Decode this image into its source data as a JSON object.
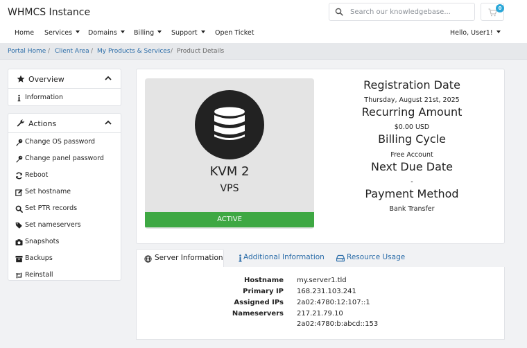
{
  "header": {
    "brand": "WHMCS Instance",
    "search_placeholder": "Search our knowledgebase...",
    "cart_count": "0"
  },
  "nav": {
    "items": [
      "Home",
      "Services",
      "Domains",
      "Billing",
      "Support",
      "Open Ticket"
    ],
    "user_menu": "Hello, User1!"
  },
  "breadcrumb": {
    "items": [
      "Portal Home",
      "Client Area",
      "My Products & Services",
      "Product Details"
    ],
    "separator": "/"
  },
  "sidebar": {
    "overview": {
      "title": "Overview",
      "items": [
        {
          "label": "Information",
          "icon": "info-icon"
        }
      ]
    },
    "actions": {
      "title": "Actions",
      "items": [
        {
          "label": "Change OS password",
          "icon": "key-icon"
        },
        {
          "label": "Change panel password",
          "icon": "key-icon"
        },
        {
          "label": "Reboot",
          "icon": "refresh-icon"
        },
        {
          "label": "Set hostname",
          "icon": "edit-icon"
        },
        {
          "label": "Set PTR records",
          "icon": "search-icon"
        },
        {
          "label": "Set nameservers",
          "icon": "tags-icon"
        },
        {
          "label": "Snapshots",
          "icon": "camera-icon"
        },
        {
          "label": "Backups",
          "icon": "archive-icon"
        },
        {
          "label": "Reinstall",
          "icon": "retweet-icon"
        }
      ]
    }
  },
  "product": {
    "name": "KVM 2",
    "group": "VPS",
    "status": "ACTIVE",
    "icon": "database-icon"
  },
  "details": {
    "registration_date_label": "Registration Date",
    "registration_date": "Thursday, August 21st, 2025",
    "recurring_amount_label": "Recurring Amount",
    "recurring_amount": "$0.00 USD",
    "billing_cycle_label": "Billing Cycle",
    "billing_cycle": "Free Account",
    "next_due_date_label": "Next Due Date",
    "next_due_date": "-",
    "payment_method_label": "Payment Method",
    "payment_method": "Bank Transfer"
  },
  "tabs": {
    "server_info": "Server Information",
    "additional_info": "Additional Information",
    "resource_usage": "Resource Usage"
  },
  "server_info": {
    "hostname_label": "Hostname",
    "hostname": "my.server1.tld",
    "primary_ip_label": "Primary IP",
    "primary_ip": "168.231.103.241",
    "assigned_ips_label": "Assigned IPs",
    "assigned_ips": "2a02:4780:12:107::1",
    "nameservers_label": "Nameservers",
    "nameservers": [
      "217.21.79.10",
      "2a02:4780:b:abcd::153"
    ]
  },
  "colors": {
    "link": "#2a6ca8",
    "active_status": "#3ea843",
    "cart_badge": "#2aa7d8",
    "product_circle": "#222222"
  }
}
